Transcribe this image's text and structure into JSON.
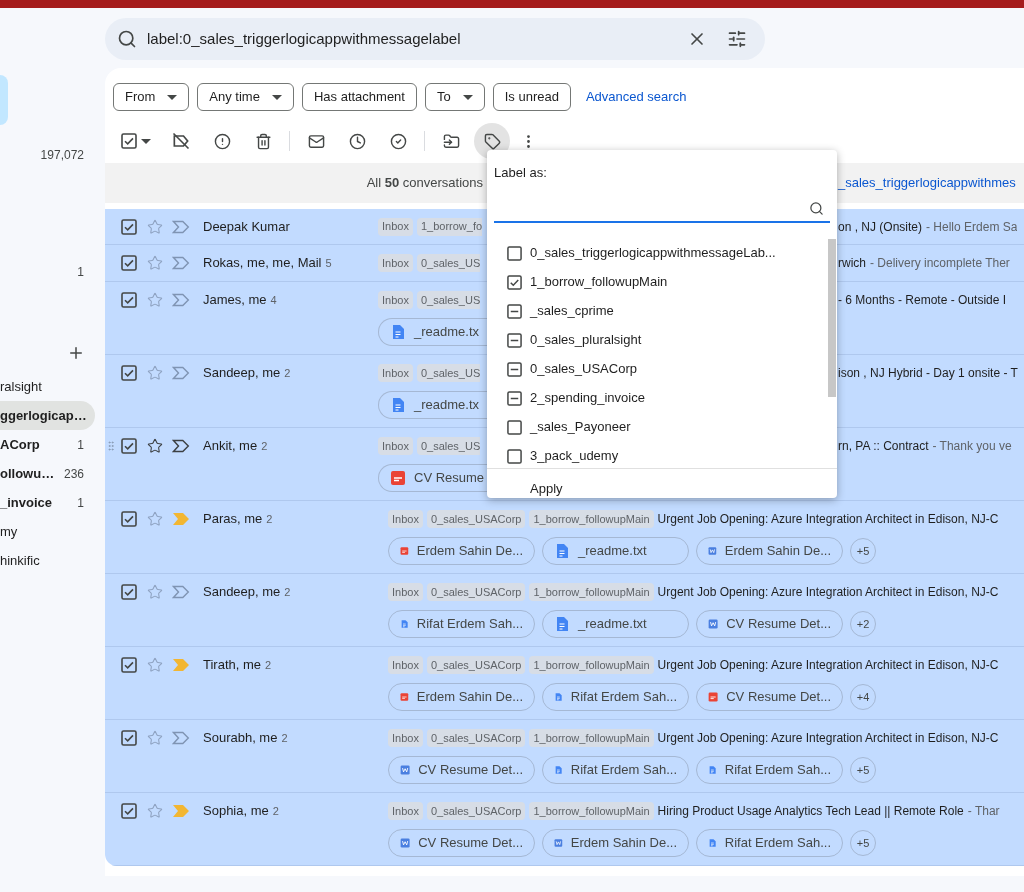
{
  "sidebar": {
    "counts": [
      "197,072",
      "1"
    ],
    "labels": [
      {
        "label": "ralsight",
        "unread": false,
        "selected": false
      },
      {
        "label": "ggerlogicap…",
        "unread": true,
        "selected": true
      },
      {
        "label": "ACorp",
        "count": "1",
        "unread": true,
        "selected": false
      },
      {
        "label": "ollowu…",
        "count": "236",
        "unread": true,
        "selected": false
      },
      {
        "label": "_invoice",
        "count": "1",
        "unread": true,
        "selected": false
      },
      {
        "label": "my",
        "unread": false,
        "selected": false
      },
      {
        "label": "hinkific",
        "unread": false,
        "selected": false
      }
    ]
  },
  "search": {
    "value": "label:0_sales_triggerlogicappwithmessagelabel"
  },
  "filters": [
    {
      "label": "From",
      "dropdown": true
    },
    {
      "label": "Any time",
      "dropdown": true
    },
    {
      "label": "Has attachment",
      "dropdown": false
    },
    {
      "label": "To",
      "dropdown": true
    },
    {
      "label": "Is unread",
      "dropdown": false
    }
  ],
  "advanced_search": "Advanced search",
  "select_all": {
    "checked": true
  },
  "selection_bar": {
    "text": "All **50** conversations",
    "link": "_sales_triggerlogicappwithmes"
  },
  "rows": [
    {
      "kind": "covered",
      "checked": true,
      "starred": false,
      "important": false,
      "hovered": false,
      "sender": "Deepak Kumar",
      "labels": [
        "Inbox",
        "1_borrow_fo"
      ],
      "subject": "on , NJ (Onsite)",
      "snippet": "- Hello Erdem Sa"
    },
    {
      "kind": "covered",
      "checked": true,
      "starred": false,
      "important": false,
      "hovered": false,
      "sender": "Rokas, me, me, Mail",
      "count": "5",
      "labels": [
        "Inbox",
        "0_sales_US"
      ],
      "subject": "rwich",
      "snippet": "- Delivery incomplete Ther"
    },
    {
      "kind": "covered",
      "checked": true,
      "starred": false,
      "important": false,
      "hovered": false,
      "sender": "James, me",
      "count": "4",
      "labels": [
        "Inbox",
        "0_sales_US"
      ],
      "subject": "- 6 Months - Remote - Outside I",
      "attachments": [
        {
          "kind": "doc",
          "name": "_readme.tx"
        }
      ]
    },
    {
      "kind": "covered",
      "checked": true,
      "starred": false,
      "important": false,
      "hovered": false,
      "sender": "Sandeep, me",
      "count": "2",
      "labels": [
        "Inbox",
        "0_sales_US"
      ],
      "subject": "ison , NJ Hybrid - Day 1 onsite - T",
      "attachments": [
        {
          "kind": "doc",
          "name": "_readme.tx"
        }
      ]
    },
    {
      "kind": "covered",
      "checked": true,
      "starred": false,
      "important": false,
      "hovered": true,
      "sender": "Ankit, me",
      "count": "2",
      "labels": [
        "Inbox",
        "0_sales_US"
      ],
      "subject": "rn, PA :: Contract",
      "snippet": "- Thank you ve",
      "attachments": [
        {
          "kind": "pdf",
          "name": "CV Resume"
        }
      ]
    },
    {
      "kind": "full",
      "checked": true,
      "starred": false,
      "important": true,
      "hovered": false,
      "sender": "Paras, me",
      "count": "2",
      "labels": [
        "Inbox",
        "0_sales_USACorp",
        "1_borrow_followupMain"
      ],
      "subject": "Urgent Job Opening: Azure Integration Architect in Edison, NJ-C",
      "attachments": [
        {
          "kind": "pdf",
          "name": "Erdem Sahin De..."
        },
        {
          "kind": "doc",
          "name": "_readme.txt"
        },
        {
          "kind": "word",
          "name": "Erdem Sahin De..."
        }
      ],
      "more": "+5"
    },
    {
      "kind": "full",
      "checked": true,
      "starred": false,
      "important": false,
      "hovered": false,
      "sender": "Sandeep, me",
      "count": "2",
      "labels": [
        "Inbox",
        "0_sales_USACorp",
        "1_borrow_followupMain"
      ],
      "subject": "Urgent Job Opening: Azure Integration Architect in Edison, NJ-C",
      "attachments": [
        {
          "kind": "doc",
          "name": "Rifat Erdem Sah..."
        },
        {
          "kind": "doc",
          "name": "_readme.txt"
        },
        {
          "kind": "word",
          "name": "CV Resume Det..."
        }
      ],
      "more": "+2"
    },
    {
      "kind": "full",
      "checked": true,
      "starred": false,
      "important": true,
      "hovered": false,
      "sender": "Tirath, me",
      "count": "2",
      "labels": [
        "Inbox",
        "0_sales_USACorp",
        "1_borrow_followupMain"
      ],
      "subject": "Urgent Job Opening: Azure Integration Architect in Edison, NJ-C",
      "attachments": [
        {
          "kind": "pdf",
          "name": "Erdem Sahin De..."
        },
        {
          "kind": "doc",
          "name": "Rifat Erdem Sah..."
        },
        {
          "kind": "pdf",
          "name": "CV Resume Det..."
        }
      ],
      "more": "+4"
    },
    {
      "kind": "full",
      "checked": true,
      "starred": false,
      "important": false,
      "hovered": false,
      "sender": "Sourabh, me",
      "count": "2",
      "labels": [
        "Inbox",
        "0_sales_USACorp",
        "1_borrow_followupMain"
      ],
      "subject": "Urgent Job Opening: Azure Integration Architect in Edison, NJ-C",
      "attachments": [
        {
          "kind": "word",
          "name": "CV Resume Det..."
        },
        {
          "kind": "doc",
          "name": "Rifat Erdem Sah..."
        },
        {
          "kind": "doc",
          "name": "Rifat Erdem Sah..."
        }
      ],
      "more": "+5"
    },
    {
      "kind": "full",
      "checked": true,
      "starred": false,
      "important": true,
      "hovered": false,
      "sender": "Sophia, me",
      "count": "2",
      "labels": [
        "Inbox",
        "0_sales_USACorp",
        "1_borrow_followupMain"
      ],
      "subject": "Hiring Product Usage Analytics Tech Lead || Remote Role",
      "snippet": "- Thar",
      "attachments": [
        {
          "kind": "word",
          "name": "CV Resume Det..."
        },
        {
          "kind": "word",
          "name": "Erdem Sahin De..."
        },
        {
          "kind": "doc",
          "name": "Rifat Erdem Sah..."
        }
      ],
      "more": "+5"
    }
  ],
  "label_menu": {
    "title": "Label as:",
    "items": [
      {
        "label": "0_sales_triggerlogicappwithmessageLab...",
        "checked": false,
        "partial": false
      },
      {
        "label": "1_borrow_followupMain",
        "checked": true,
        "partial": false
      },
      {
        "label": "_sales_cprime",
        "checked": false,
        "partial": true
      },
      {
        "label": "0_sales_pluralsight",
        "checked": false,
        "partial": true
      },
      {
        "label": "0_sales_USACorp",
        "checked": false,
        "partial": true
      },
      {
        "label": "2_spending_invoice",
        "checked": false,
        "partial": true
      },
      {
        "label": "_sales_Payoneer",
        "checked": false,
        "partial": false
      },
      {
        "label": "3_pack_udemy",
        "checked": false,
        "partial": false
      }
    ],
    "apply": "Apply"
  }
}
